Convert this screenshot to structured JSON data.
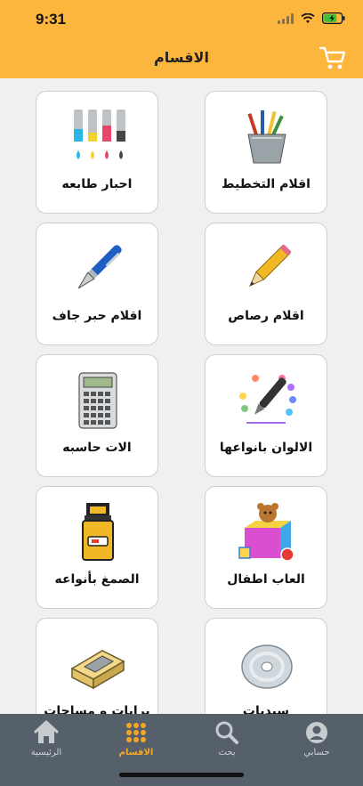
{
  "status_bar": {
    "time": "9:31"
  },
  "header": {
    "title": "الاقسام"
  },
  "categories": [
    {
      "label": "اقلام التخطيط",
      "icon": "pencil-cup-icon"
    },
    {
      "label": "احبار طابعه",
      "icon": "ink-cartridges-icon"
    },
    {
      "label": "اقلام رصاص",
      "icon": "pencil-icon"
    },
    {
      "label": "اقلام حبر جاف",
      "icon": "fountain-pen-icon"
    },
    {
      "label": "الالوان بانواعها",
      "icon": "colors-brush-icon"
    },
    {
      "label": "الات حاسبه",
      "icon": "calculator-icon"
    },
    {
      "label": "العاب اطفال",
      "icon": "toy-box-icon"
    },
    {
      "label": "الصمغ بأنواعه",
      "icon": "glue-icon"
    },
    {
      "label": "سيديات",
      "icon": "cd-icon"
    },
    {
      "label": "برايات و مساحات",
      "icon": "sharpener-icon"
    }
  ],
  "tabs": [
    {
      "label": "حسابي",
      "icon": "account-icon",
      "active": false
    },
    {
      "label": "بحث",
      "icon": "search-icon",
      "active": false
    },
    {
      "label": "الاقسام",
      "icon": "grid-icon",
      "active": true
    },
    {
      "label": "الرئيسية",
      "icon": "home-icon",
      "active": false
    }
  ],
  "colors": {
    "header": "#fcb53d",
    "tabbar": "#56606a",
    "active_tab": "#f6a623"
  }
}
